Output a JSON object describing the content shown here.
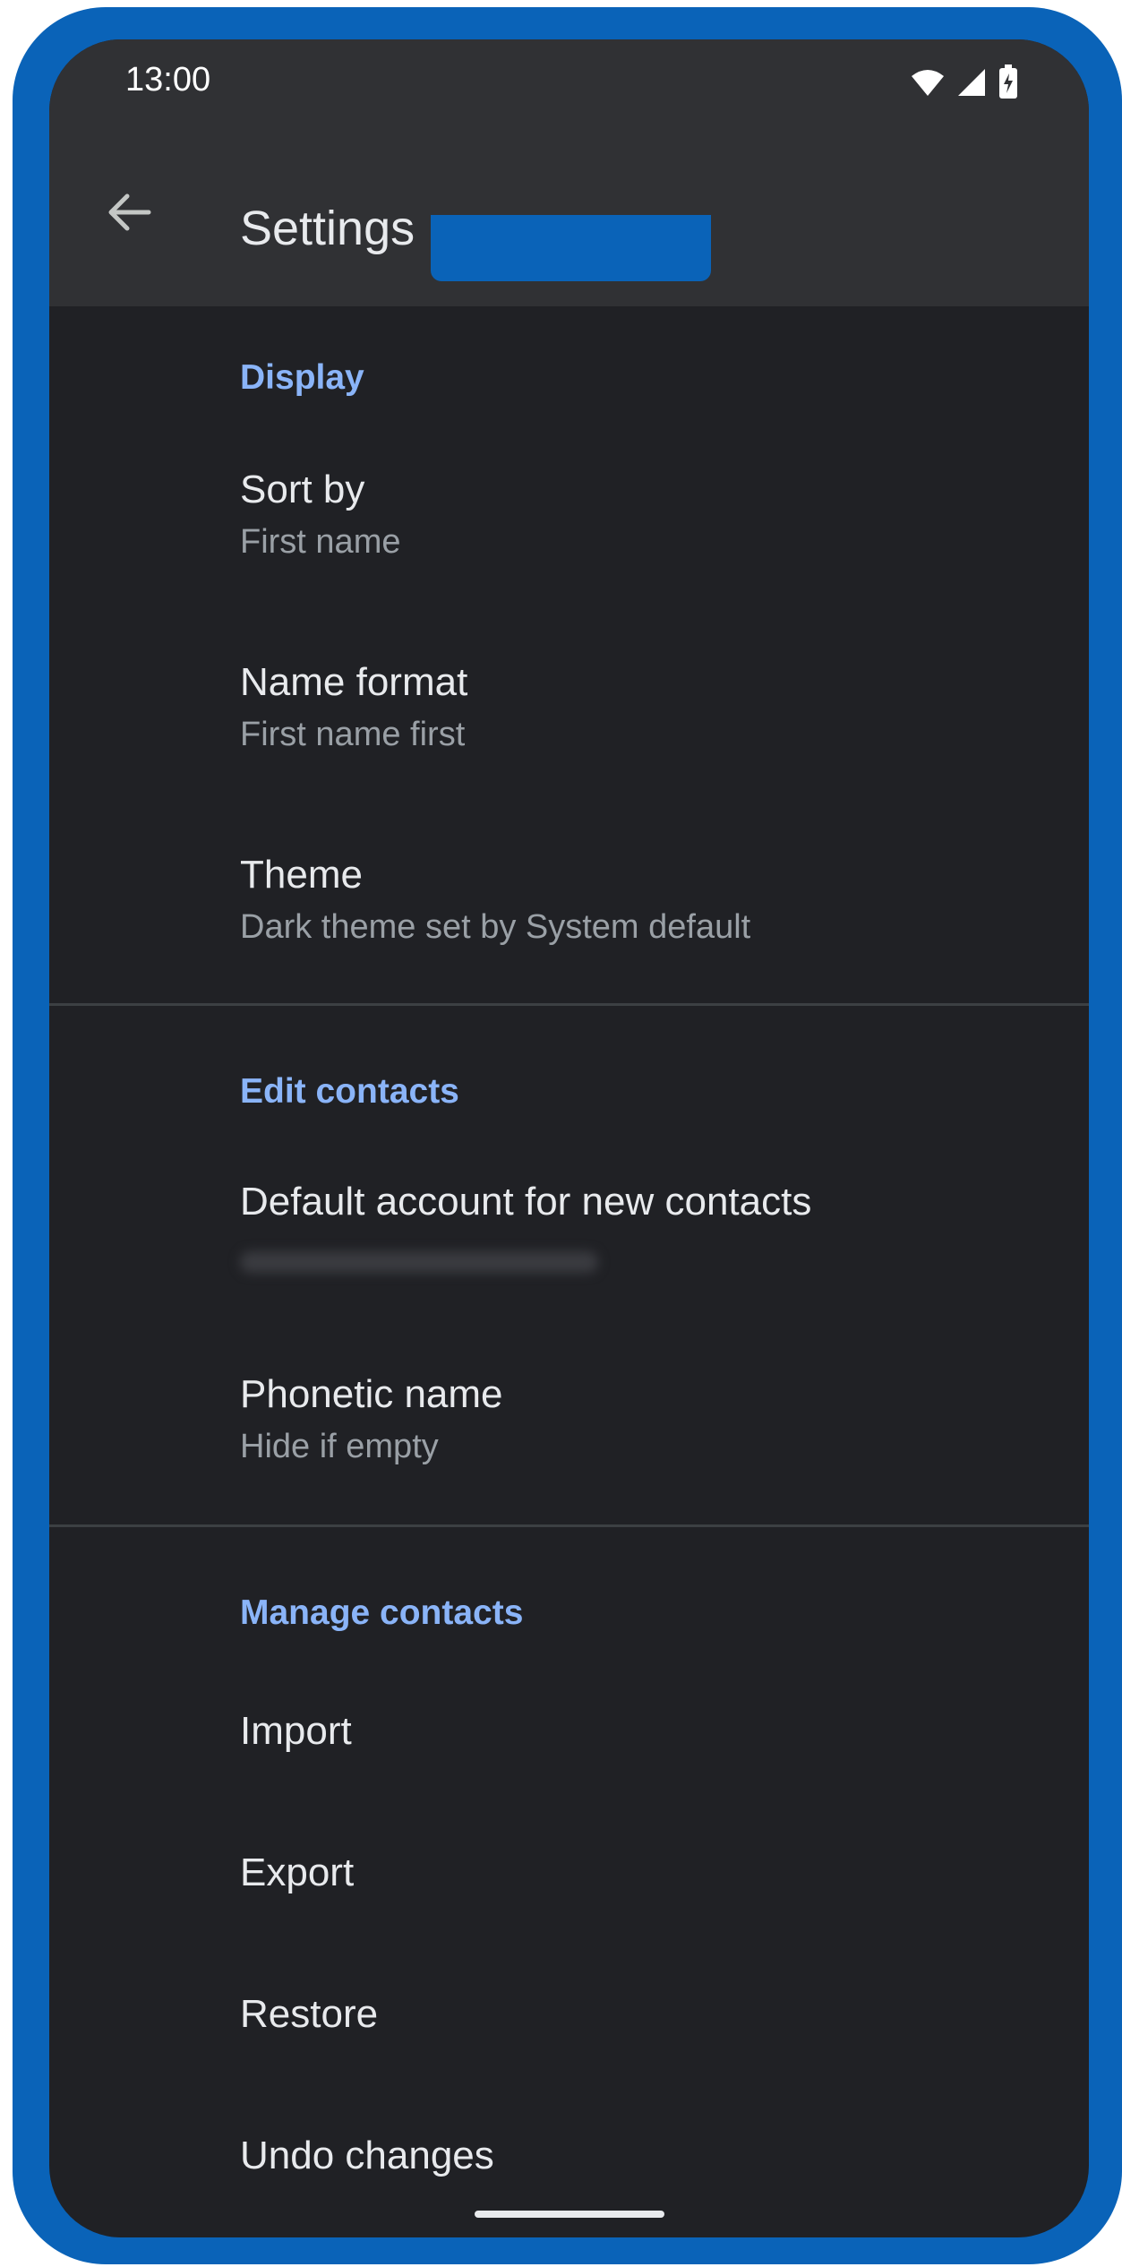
{
  "status_bar": {
    "time": "13:00",
    "icons": [
      "wifi-icon",
      "signal-icon",
      "battery-charging-icon"
    ]
  },
  "app_bar": {
    "title": "Settings",
    "back_icon": "arrow-back-icon"
  },
  "sections": [
    {
      "header": "Display",
      "items": [
        {
          "title": "Sort by",
          "subtitle": "First name"
        },
        {
          "title": "Name format",
          "subtitle": "First name first"
        },
        {
          "title": "Theme",
          "subtitle": "Dark theme set by System default"
        }
      ]
    },
    {
      "header": "Edit contacts",
      "items": [
        {
          "title": "Default account for new contacts",
          "subtitle": ""
        },
        {
          "title": "Phonetic name",
          "subtitle": "Hide if empty"
        }
      ]
    },
    {
      "header": "Manage contacts",
      "items": [
        {
          "title": "Import"
        },
        {
          "title": "Export"
        },
        {
          "title": "Restore"
        },
        {
          "title": "Undo changes"
        }
      ]
    }
  ],
  "colors": {
    "frame": "#0a63b8",
    "background": "#202125",
    "app_bar": "#303134",
    "accent": "#8ab4f8",
    "text_primary": "#e8eaed",
    "text_secondary": "#9aa0a6"
  }
}
